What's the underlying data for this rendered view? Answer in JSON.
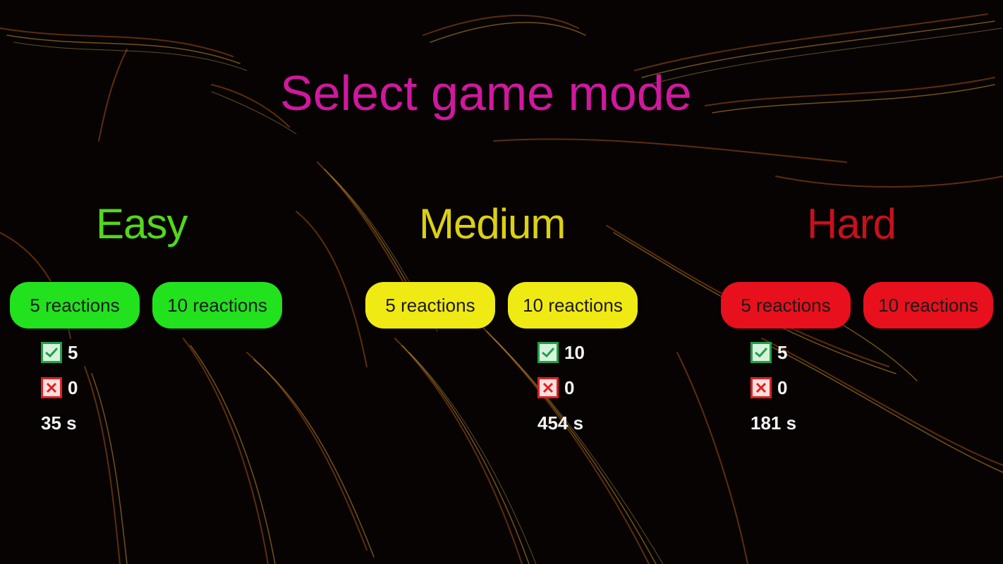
{
  "title": "Select game mode",
  "colors": {
    "title": "#d0189e",
    "easy": "#52d81c",
    "medium": "#dcd014",
    "hard": "#c8101c",
    "easy_button": "#22e21e",
    "medium_button": "#f0ea14",
    "hard_button": "#e8101c"
  },
  "modes": [
    {
      "name": "Easy",
      "buttons": [
        "5 reactions",
        "10 reactions"
      ],
      "stats": {
        "correct": "5",
        "wrong": "0",
        "time": "35 s"
      }
    },
    {
      "name": "Medium",
      "buttons": [
        "5 reactions",
        "10 reactions"
      ],
      "stats": {
        "correct": "10",
        "wrong": "0",
        "time": "454 s"
      }
    },
    {
      "name": "Hard",
      "buttons": [
        "5 reactions",
        "10 reactions"
      ],
      "stats": {
        "correct": "5",
        "wrong": "0",
        "time": "181 s"
      }
    }
  ],
  "icons": {
    "correct": "check-icon",
    "wrong": "cross-icon"
  }
}
